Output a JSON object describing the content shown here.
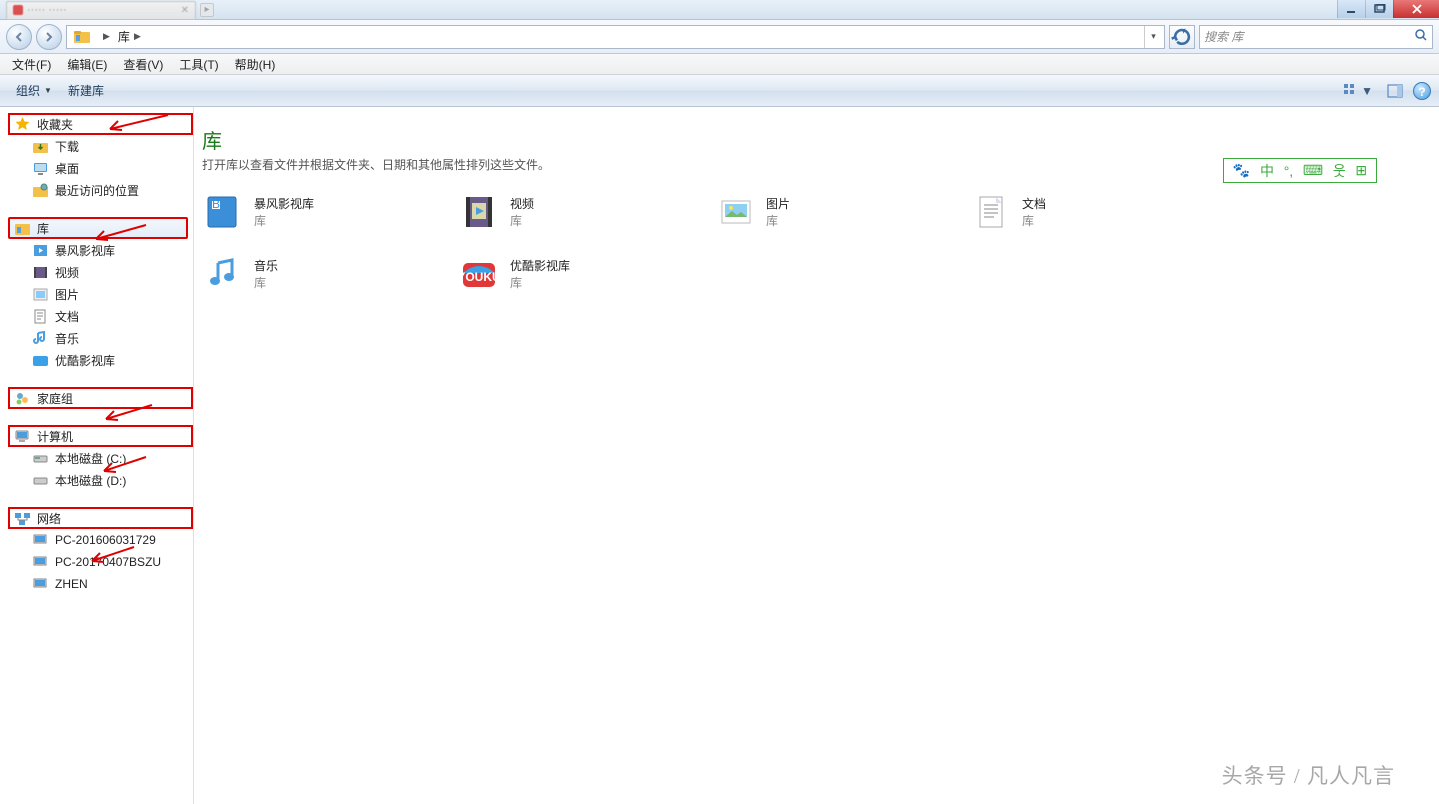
{
  "titlebar": {
    "tab_label": "····· ·····"
  },
  "nav": {
    "crumb_label": "库",
    "search_placeholder": "搜索 库"
  },
  "menu": {
    "file": "文件(F)",
    "edit": "编辑(E)",
    "view": "查看(V)",
    "tools": "工具(T)",
    "help": "帮助(H)"
  },
  "toolbar": {
    "organize": "组织",
    "newlib": "新建库"
  },
  "sidebar": {
    "favorites": {
      "label": "收藏夹",
      "items": [
        "下载",
        "桌面",
        "最近访问的位置"
      ]
    },
    "libraries": {
      "label": "库",
      "items": [
        "暴风影视库",
        "视频",
        "图片",
        "文档",
        "音乐",
        "优酷影视库"
      ]
    },
    "homegroup": {
      "label": "家庭组"
    },
    "computer": {
      "label": "计算机",
      "items": [
        "本地磁盘 (C:)",
        "本地磁盘 (D:)"
      ]
    },
    "network": {
      "label": "网络",
      "items": [
        "PC-201606031729",
        "PC-20170407BSZU",
        "ZHEN"
      ]
    }
  },
  "content": {
    "title": "库",
    "subtitle": "打开库以查看文件并根据文件夹、日期和其他属性排列这些文件。",
    "lib_sub": "库",
    "items": [
      {
        "name": "暴风影视库",
        "icon": "baofeng"
      },
      {
        "name": "视频",
        "icon": "video"
      },
      {
        "name": "图片",
        "icon": "pictures"
      },
      {
        "name": "文档",
        "icon": "documents"
      },
      {
        "name": "音乐",
        "icon": "music"
      },
      {
        "name": "优酷影视库",
        "icon": "youku"
      }
    ]
  },
  "watermark": "头条号 / 凡人凡言"
}
